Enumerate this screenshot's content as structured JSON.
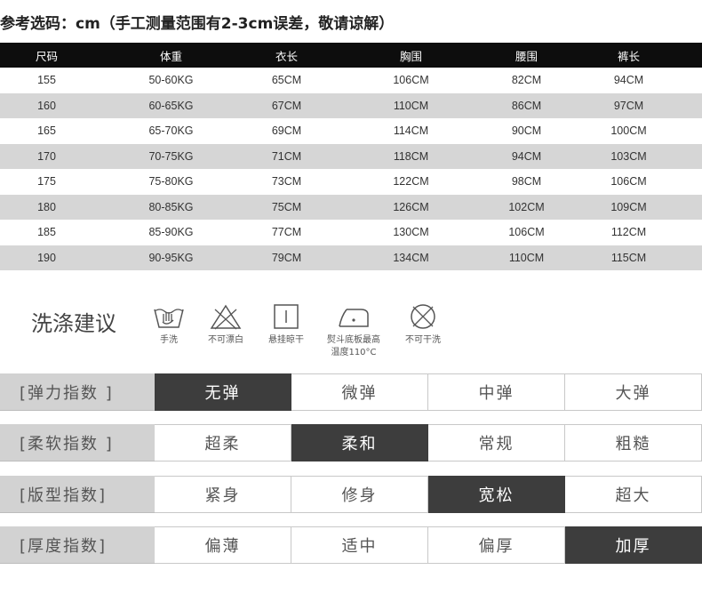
{
  "title": "参考选码：cm（手工测量范围有2-3cm误差，敬请谅解）",
  "size_table": {
    "headers": [
      "尺码",
      "体重",
      "衣长",
      "胸围",
      "腰围",
      "裤长"
    ],
    "rows": [
      [
        "155",
        "50-60KG",
        "65CM",
        "106CM",
        "82CM",
        "94CM"
      ],
      [
        "160",
        "60-65KG",
        "67CM",
        "110CM",
        "86CM",
        "97CM"
      ],
      [
        "165",
        "65-70KG",
        "69CM",
        "114CM",
        "90CM",
        "100CM"
      ],
      [
        "170",
        "70-75KG",
        "71CM",
        "118CM",
        "94CM",
        "103CM"
      ],
      [
        "175",
        "75-80KG",
        "73CM",
        "122CM",
        "98CM",
        "106CM"
      ],
      [
        "180",
        "80-85KG",
        "75CM",
        "126CM",
        "102CM",
        "109CM"
      ],
      [
        "185",
        "85-90KG",
        "77CM",
        "130CM",
        "106CM",
        "112CM"
      ],
      [
        "190",
        "90-95KG",
        "79CM",
        "134CM",
        "110CM",
        "115CM"
      ]
    ]
  },
  "washing": {
    "title": "洗涤建议",
    "items": [
      {
        "label": "手洗",
        "icon": "hand-wash-icon"
      },
      {
        "label": "不可漂白",
        "icon": "no-bleach-icon"
      },
      {
        "label": "悬挂晾干",
        "icon": "hang-dry-icon"
      },
      {
        "label": "熨斗底板最高",
        "label2": "温度110°C",
        "icon": "iron-icon"
      },
      {
        "label": "不可干洗",
        "icon": "no-dry-clean-icon"
      }
    ]
  },
  "indices": [
    {
      "label": "[弹力指数 ]",
      "options": [
        "无弹",
        "微弹",
        "中弹",
        "大弹"
      ],
      "active": 0
    },
    {
      "label": "[柔软指数 ]",
      "options": [
        "超柔",
        "柔和",
        "常规",
        "粗糙"
      ],
      "active": 1
    },
    {
      "label": "[版型指数]",
      "options": [
        "紧身",
        "修身",
        "宽松",
        "超大"
      ],
      "active": 2
    },
    {
      "label": "[厚度指数]",
      "options": [
        "偏薄",
        "适中",
        "偏厚",
        "加厚"
      ],
      "active": 3
    }
  ],
  "colors": {
    "header_bg": "#0d0d0d",
    "alt_row": "#d6d6d6",
    "active": "#3d3d3d",
    "label_bg": "#d2d2d2"
  }
}
